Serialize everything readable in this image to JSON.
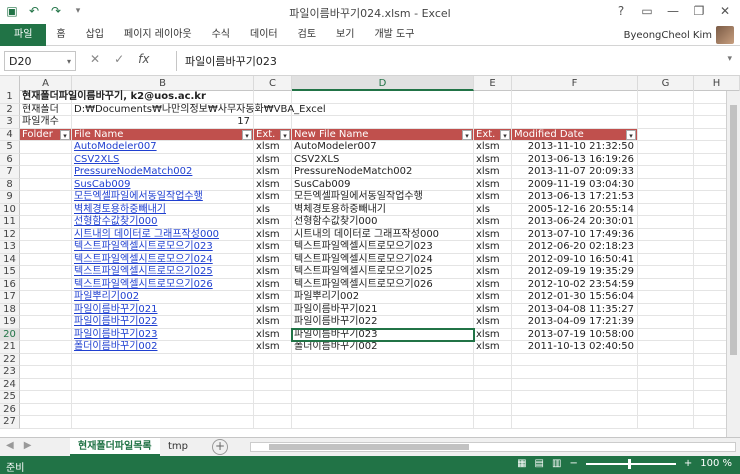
{
  "window": {
    "title": "파일이름바꾸기024.xlsm - Excel",
    "qat": [
      "save-icon",
      "undo-icon",
      "redo-icon"
    ],
    "controls": [
      "?",
      "▭",
      "—",
      "❐",
      "✕"
    ]
  },
  "ribbon": {
    "tabs": [
      "파일",
      "홈",
      "삽입",
      "페이지 레이아웃",
      "수식",
      "데이터",
      "검토",
      "보기",
      "개발 도구"
    ],
    "user": "ByeongCheol Kim"
  },
  "formula_bar": {
    "name_box": "D20",
    "icon_cancel": "✕",
    "icon_enter": "✓",
    "icon_fx": "fx",
    "content": "파일이름바꾸기023"
  },
  "columns": [
    "A",
    "B",
    "C",
    "D",
    "E",
    "F",
    "G",
    "H"
  ],
  "rows": [
    "1",
    "2",
    "3",
    "4",
    "5",
    "6",
    "7",
    "8",
    "9",
    "10",
    "11",
    "12",
    "13",
    "14",
    "15",
    "16",
    "17",
    "18",
    "19",
    "20",
    "21",
    "22",
    "23",
    "24",
    "25",
    "26",
    "27"
  ],
  "sheet": {
    "r1_title": "현재폴더파일이름바꾸기, k2@uos.ac.kr",
    "r2_label": "현재폴더",
    "r2_path": "D:₩Documents₩나만의정보₩사무자동화₩VBA_Excel",
    "r3_label": "파일개수",
    "r3_count": "17",
    "headers": [
      "Folder",
      "File Name",
      "Ext.",
      "New File Name",
      "Ext.",
      "Modified Date"
    ],
    "data": [
      {
        "file": "AutoModeler007",
        "ext": "xlsm",
        "new": "AutoModeler007",
        "ext2": "xlsm",
        "date": "2013-11-10 21:32:50"
      },
      {
        "file": "CSV2XLS",
        "ext": "xlsm",
        "new": "CSV2XLS",
        "ext2": "xlsm",
        "date": "2013-06-13 16:19:26"
      },
      {
        "file": "PressureNodeMatch002",
        "ext": "xlsm",
        "new": "PressureNodeMatch002",
        "ext2": "xlsm",
        "date": "2013-11-07 20:09:33"
      },
      {
        "file": "SusCab009",
        "ext": "xlsm",
        "new": "SusCab009",
        "ext2": "xlsm",
        "date": "2009-11-19 03:04:30"
      },
      {
        "file": "모든엑셀파일에서동일작업수행",
        "ext": "xlsm",
        "new": "모든엑셀파일에서동일작업수행",
        "ext2": "xlsm",
        "date": "2013-06-13 17:21:53"
      },
      {
        "file": "벽체경토용하중빼내기",
        "ext": "xls",
        "new": "벽체경토용하중빼내기",
        "ext2": "xls",
        "date": "2005-12-16 20:55:14"
      },
      {
        "file": "선형함수값찾기000",
        "ext": "xlsm",
        "new": "선형함수값찾기000",
        "ext2": "xlsm",
        "date": "2013-06-24 20:30:01"
      },
      {
        "file": "시트내의 데이터로 그래프작성000",
        "ext": "xlsm",
        "new": "시트내의 데이터로 그래프작성000",
        "ext2": "xlsm",
        "date": "2013-07-10 17:49:36"
      },
      {
        "file": "텍스트파일엑셀시트로모으기023",
        "ext": "xlsm",
        "new": "텍스트파일엑셀시트로모으기023",
        "ext2": "xlsm",
        "date": "2012-06-20 02:18:23"
      },
      {
        "file": "텍스트파일엑셀시트로모으기024",
        "ext": "xlsm",
        "new": "텍스트파일엑셀시트로모으기024",
        "ext2": "xlsm",
        "date": "2012-09-10 16:50:41"
      },
      {
        "file": "텍스트파일엑셀시트로모으기025",
        "ext": "xlsm",
        "new": "텍스트파일엑셀시트로모으기025",
        "ext2": "xlsm",
        "date": "2012-09-19 19:35:29"
      },
      {
        "file": "텍스트파일엑셀시트로모으기026",
        "ext": "xlsm",
        "new": "텍스트파일엑셀시트로모으기026",
        "ext2": "xlsm",
        "date": "2012-10-02 23:54:59"
      },
      {
        "file": "파일뿌리기002",
        "ext": "xlsm",
        "new": "파일뿌리기002",
        "ext2": "xlsm",
        "date": "2012-01-30 15:56:04"
      },
      {
        "file": "파일이름바꾸기021",
        "ext": "xlsm",
        "new": "파일이름바꾸기021",
        "ext2": "xlsm",
        "date": "2013-04-08 11:35:27"
      },
      {
        "file": "파일이름바꾸기022",
        "ext": "xlsm",
        "new": "파일이름바꾸기022",
        "ext2": "xlsm",
        "date": "2013-04-09 17:21:39"
      },
      {
        "file": "파일이름바꾸기023",
        "ext": "xlsm",
        "new": "파일이름바꾸기023",
        "ext2": "xlsm",
        "date": "2013-07-19 10:58:00"
      },
      {
        "file": "폴더이름바꾸기002",
        "ext": "xlsm",
        "new": "폴더이름바꾸기002",
        "ext2": "xlsm",
        "date": "2011-10-13 02:40:50"
      }
    ]
  },
  "sheet_tabs": [
    "현재폴더파일목록",
    "tmp"
  ],
  "active_sheet": "현재폴더파일목록",
  "status": {
    "ready": "준비",
    "zoom": "100 %"
  },
  "colors": {
    "accent": "#217346",
    "header_fill": "#c0504d",
    "link": "#1f3fd0"
  }
}
